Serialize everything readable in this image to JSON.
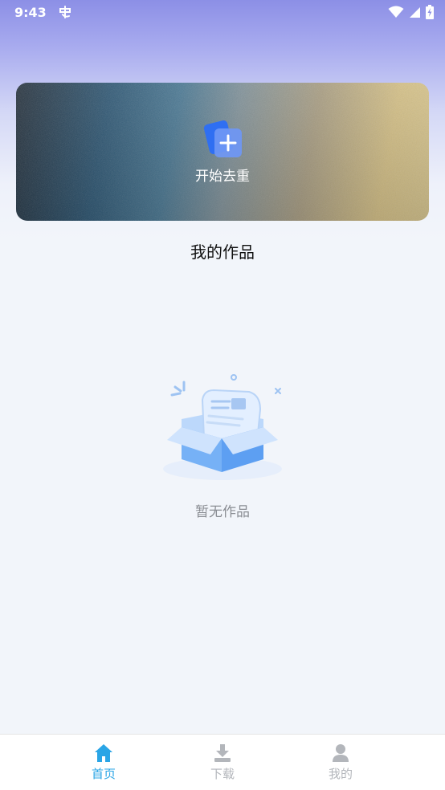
{
  "status_bar": {
    "time": "9:43",
    "notification_icon": "app-notification-icon",
    "icons": [
      "wifi-icon",
      "signal-icon",
      "battery-charging-icon"
    ]
  },
  "start_card": {
    "icon": "add-document-icon",
    "label": "开始去重"
  },
  "works_section": {
    "title": "我的作品",
    "empty_illustration": "empty-box-icon",
    "empty_text": "暂无作品"
  },
  "tab_bar": {
    "tabs": [
      {
        "label": "首页",
        "icon": "home-icon",
        "active": true
      },
      {
        "label": "下载",
        "icon": "download-icon",
        "active": false
      },
      {
        "label": "我的",
        "icon": "profile-icon",
        "active": false
      }
    ],
    "active_color": "#2aa5e6",
    "inactive_color": "#b3b6bb"
  }
}
